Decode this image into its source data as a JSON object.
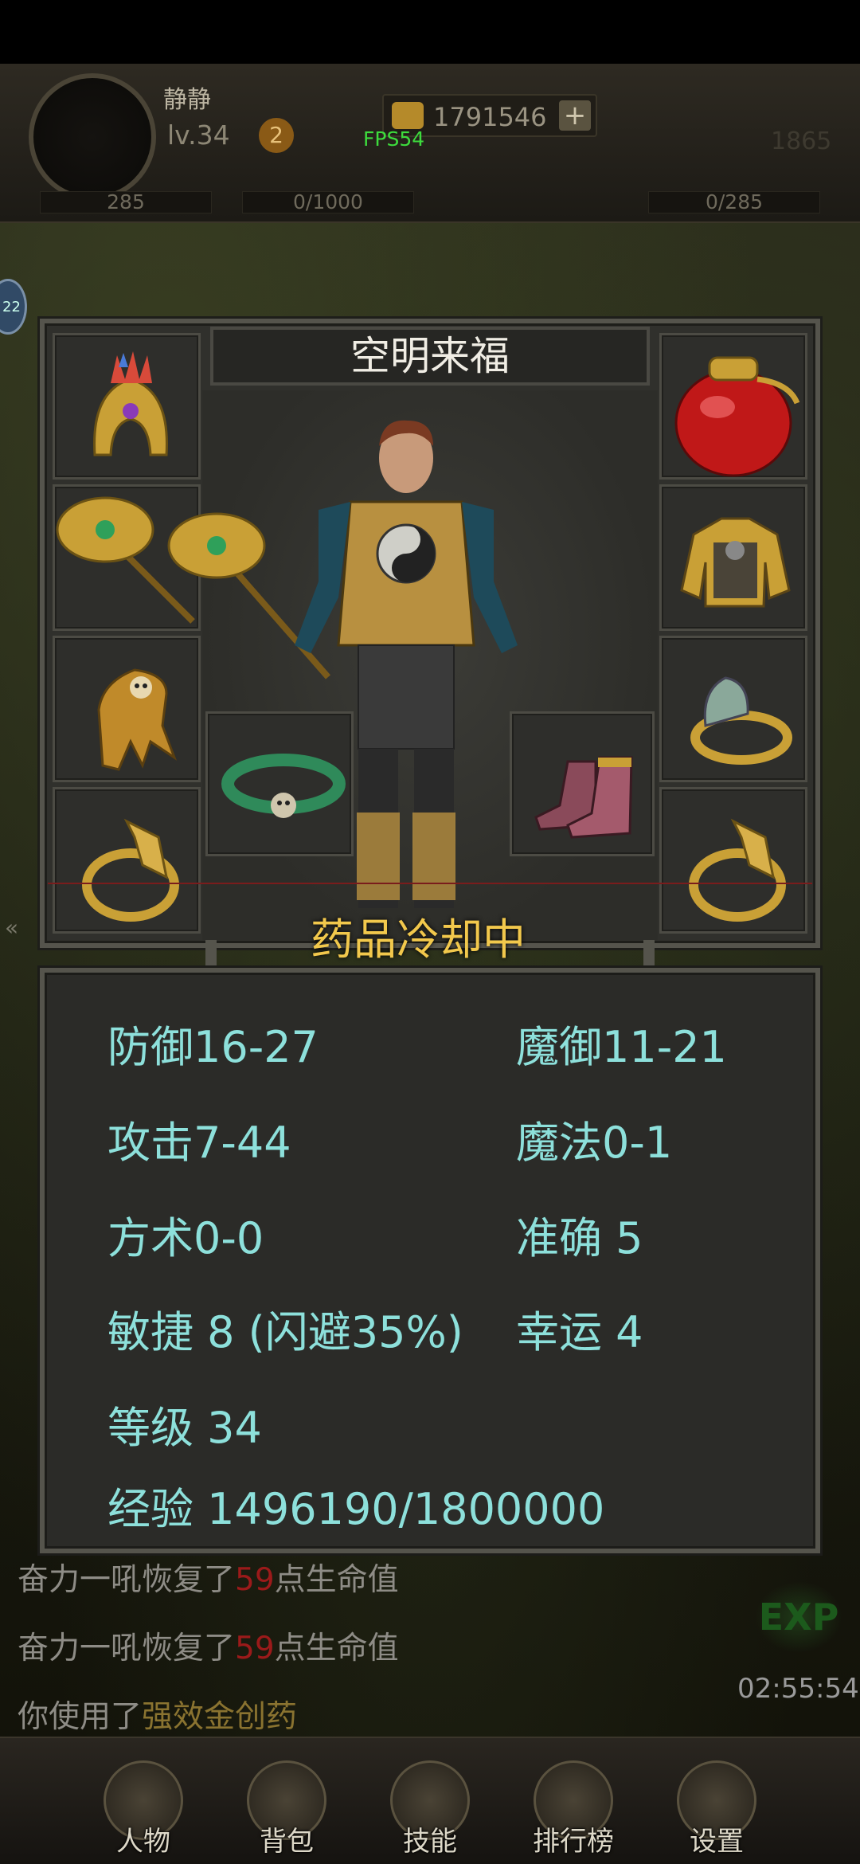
{
  "hud": {
    "player_name": "静静",
    "player_level": "lv.34",
    "level_badge": "2",
    "gold": "1791546",
    "gold_plus": "+",
    "fps": "FPS54",
    "power_value": "1865",
    "bar_left": "285",
    "bar_mid": "0/1000",
    "bar_right": "0/285",
    "side_tab": "22"
  },
  "panel": {
    "character_name": "空明来福",
    "cooldown_text": "药品冷却中",
    "slots": [
      "helmet",
      "medicine-jar",
      "weapon-axe",
      "armor",
      "gloves",
      "bracelet",
      "necklace",
      "boots",
      "ring-left",
      "ring-right"
    ]
  },
  "stats": {
    "defense": "防御16-27",
    "magic_defense": "魔御11-21",
    "attack": "攻击7-44",
    "magic": "魔法0-1",
    "taoism": "方术0-0",
    "accuracy": "准确 5",
    "agility": "敏捷 8 (闪避35%)",
    "luck": "幸运 4",
    "level": "等级 34",
    "experience": "经验 1496190/1800000"
  },
  "chat": {
    "line1_prefix": "奋力一吼恢复了",
    "line1_num": "59",
    "line1_suffix": "点生命值",
    "line2_prefix": "奋力一吼恢复了",
    "line2_num": "59",
    "line2_suffix": "点生命值",
    "line3_prefix": "你使用了",
    "line3_item": "强效金创药",
    "clock": "02:55:54",
    "exp_button": "EXP"
  },
  "nav": {
    "items": [
      {
        "label": "人物",
        "icon": "character-icon"
      },
      {
        "label": "背包",
        "icon": "bag-icon"
      },
      {
        "label": "技能",
        "icon": "skill-icon"
      },
      {
        "label": "排行榜",
        "icon": "ranking-icon"
      },
      {
        "label": "设置",
        "icon": "settings-icon"
      }
    ]
  },
  "colors": {
    "stat_text": "#8de0db",
    "cooldown": "#f2c84c",
    "panel_border": "#55544c",
    "chat_number": "#9b1a1a"
  }
}
